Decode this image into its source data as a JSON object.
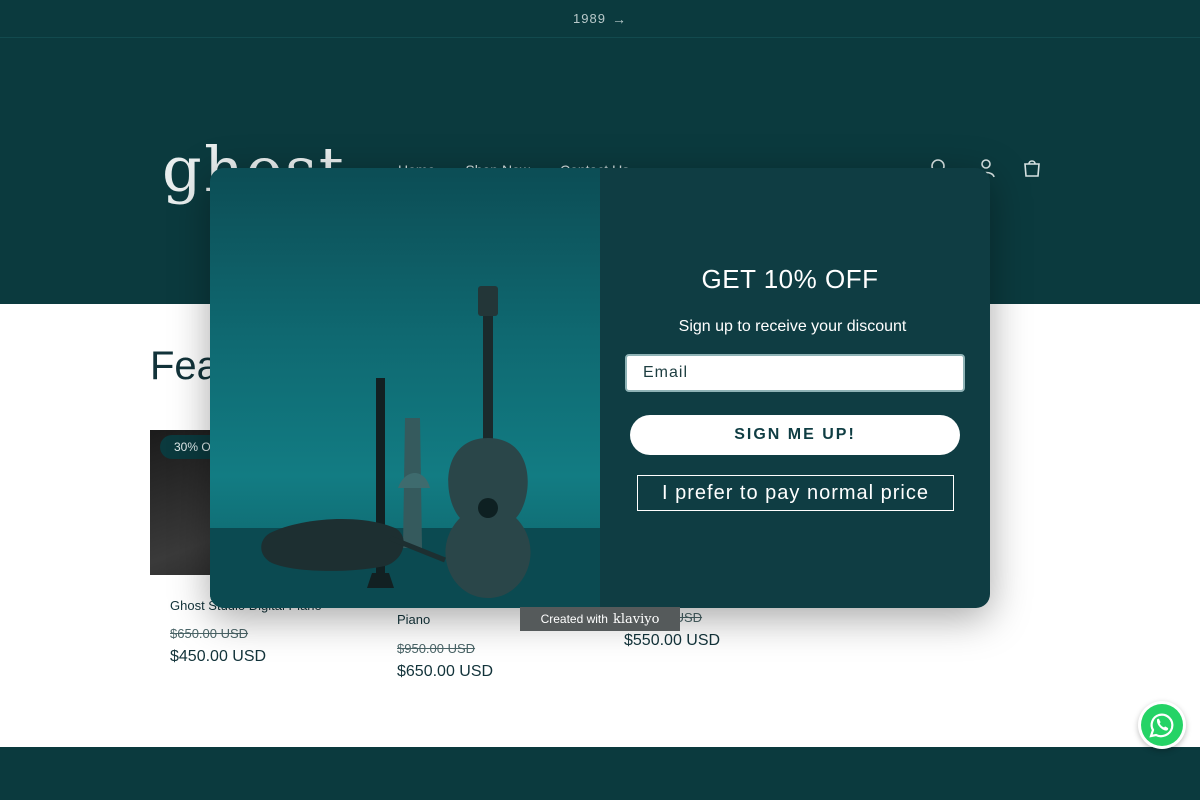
{
  "announcement": {
    "text": "1989",
    "arrow": "→"
  },
  "header": {
    "logo_text": "ghost",
    "nav": [
      "Home",
      "Shop Now",
      "Contact Us"
    ]
  },
  "section": {
    "title": "Featured collection"
  },
  "products": [
    {
      "badge": "30% OFF",
      "name": "Ghost Studio Digital Piano",
      "old_price": "$650.00 USD",
      "new_price": "$450.00 USD"
    },
    {
      "name": "Piano",
      "old_price": "$950.00 USD",
      "new_price": "$650.00 USD"
    },
    {
      "old_price": "$750.00 USD",
      "new_price": "$550.00 USD"
    }
  ],
  "popup": {
    "title": "GET 10% OFF",
    "subtitle": "Sign up to receive your discount",
    "email_placeholder": "Email",
    "signup_label": "SIGN ME UP!",
    "decline_label": "I prefer to pay normal price"
  },
  "klaviyo": {
    "created_with": "Created with",
    "brand": "klaviyo"
  },
  "colors": {
    "primary": "#0b3a3e",
    "popup_bg": "#0f3d43",
    "accent": "#ffffff"
  },
  "icons": [
    "search-icon",
    "account-icon",
    "cart-icon",
    "arrow-right-icon",
    "whatsapp-icon"
  ]
}
